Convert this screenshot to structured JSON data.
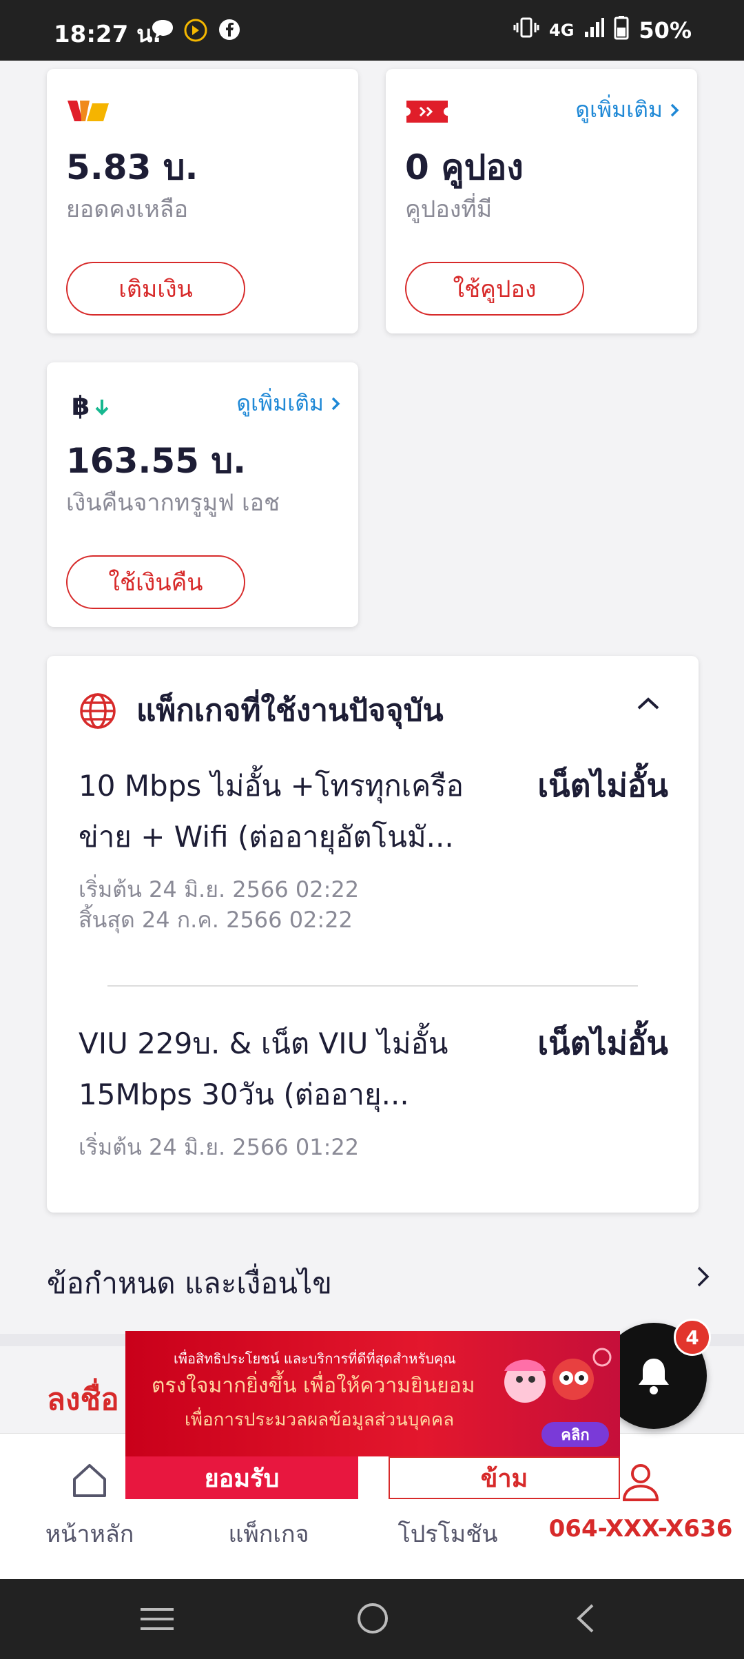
{
  "status_bar": {
    "time": "18:27 น.",
    "network": "4G",
    "battery": "50%"
  },
  "cards": {
    "balance": {
      "amount": "5.83 บ.",
      "label": "ยอดคงเหลือ",
      "button": "เติมเงิน"
    },
    "coupon": {
      "more": "ดูเพิ่มเติม",
      "amount": "0  คูปอง",
      "label": "คูปองที่มี",
      "button": "ใช้คูปอง"
    },
    "cashback": {
      "more": "ดูเพิ่มเติม",
      "amount": "163.55  บ.",
      "label": "เงินคืนจากทรูมูฟ เอช",
      "button": "ใช้เงินคืน"
    }
  },
  "packages": {
    "title": "แพ็กเกจที่ใช้งานปัจจุบัน",
    "items": [
      {
        "name_line1": "10 Mbps ไม่อั้น +โทรทุกเครือ",
        "name_line2": "ข่าย + Wifi (ต่ออายุอัตโนมั...",
        "badge": "เน็ตไม่อั้น",
        "start": "เริ่มต้น 24 มิ.ย. 2566 02:22",
        "end": "สิ้นสุด 24 ก.ค. 2566 02:22"
      },
      {
        "name_line1": "VIU 229บ. & เน็ต VIU ไม่อั้น",
        "name_line2": "15Mbps 30วัน (ต่ออายุ...",
        "badge": "เน็ตไม่อั้น",
        "start": "เริ่มต้น 24 มิ.ย. 2566 01:22"
      }
    ]
  },
  "terms": {
    "label": "ข้อกำหนด และเงื่อนไข"
  },
  "register": {
    "label": "ลงชื่อ"
  },
  "notification": {
    "count": "4"
  },
  "consent_banner": {
    "line1": "เพื่อสิทธิประโยชน์ และบริการที่ดีที่สุดสำหรับคุณ",
    "line2": "ตรงใจมากยิ่งขึ้น เพื่อให้ความยินยอม",
    "line3": "เพื่อการประมวลผลข้อมูลส่วนบุคคล",
    "click": "คลิก",
    "accept": "ยอมรับ",
    "skip": "ข้าม"
  },
  "bottom_nav": {
    "home": "หน้าหลัก",
    "package": "แพ็กเกจ",
    "promotion": "โปรโมชัน",
    "account": "064-XXX-X636"
  },
  "colors": {
    "brand_red": "#d72a2a",
    "link_blue": "#1e88d6",
    "accept_pink": "#e8173f"
  }
}
